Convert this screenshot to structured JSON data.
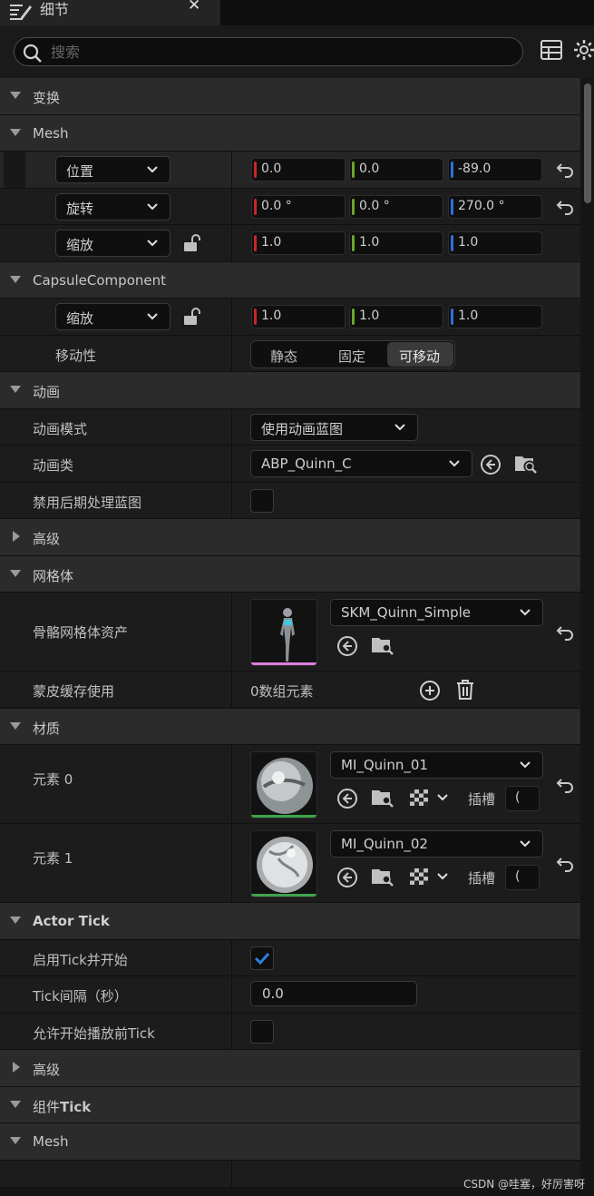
{
  "tab": {
    "title": "细节",
    "close": "✕"
  },
  "search": {
    "placeholder": "搜索"
  },
  "sections": {
    "transform": "变换",
    "mesh_sub": "Mesh",
    "capsule": "CapsuleComponent",
    "animation": "动画",
    "advanced1": "高级",
    "mesh_group": "网格体",
    "material": "材质",
    "actor_tick": "Actor Tick",
    "advanced2": "高级",
    "component_tick_prefix": "组件",
    "component_tick_suffix": "Tick",
    "mesh_last": "Mesh"
  },
  "transform_mesh": {
    "location": {
      "label": "位置",
      "x": "0.0",
      "y": "0.0",
      "z": "-89.0"
    },
    "rotation": {
      "label": "旋转",
      "x": "0.0 °",
      "y": "0.0 °",
      "z": "270.0 °"
    },
    "scale": {
      "label": "缩放",
      "x": "1.0",
      "y": "1.0",
      "z": "1.0"
    }
  },
  "capsule": {
    "scale": {
      "label": "缩放",
      "x": "1.0",
      "y": "1.0",
      "z": "1.0"
    },
    "mobility": {
      "label": "移动性",
      "options": [
        "静态",
        "固定",
        "可移动"
      ],
      "selected": "可移动"
    }
  },
  "animation": {
    "mode_label": "动画模式",
    "mode_value": "使用动画蓝图",
    "class_label": "动画类",
    "class_value": "ABP_Quinn_C",
    "disable_pp_label": "禁用后期处理蓝图",
    "disable_pp_checked": false
  },
  "mesh": {
    "skeletal_label": "骨骼网格体资产",
    "skeletal_value": "SKM_Quinn_Simple",
    "skin_cache_label": "蒙皮缓存使用",
    "skin_cache_value": "0数组元素"
  },
  "materials": [
    {
      "label": "元素 0",
      "value": "MI_Quinn_01",
      "slot_label": "插槽",
      "slot_value": "("
    },
    {
      "label": "元素 1",
      "value": "MI_Quinn_02",
      "slot_label": "插槽",
      "slot_value": "("
    }
  ],
  "actor_tick": {
    "start_label": "启用Tick并开始",
    "start_checked": true,
    "interval_label": "Tick间隔（秒）",
    "interval_value": "0.0",
    "before_label": "允许开始播放前Tick",
    "before_checked": false
  },
  "colors": {
    "x_axis": "#c8262b",
    "y_axis": "#6aa62a",
    "z_axis": "#2f6fdc",
    "check": "#2d7fe0",
    "skeletal_underline": "#e07ce0",
    "material_underline": "#3fa34d"
  },
  "watermark": "CSDN @哇塞，好厉害呀"
}
